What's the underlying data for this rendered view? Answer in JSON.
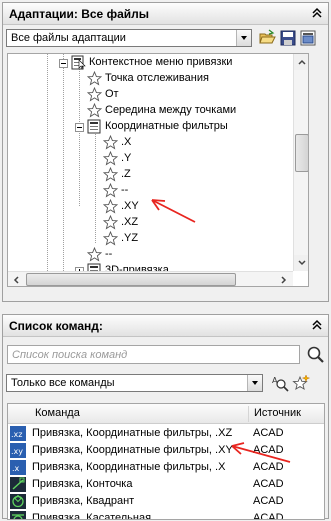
{
  "adapt": {
    "title": "Адаптации: Все файлы",
    "dropdown_value": "Все файлы адаптации",
    "tree": [
      {
        "label": "Контекстное меню привязки",
        "icon": "menu-group-icon"
      },
      {
        "label": "Точка отслеживания",
        "icon": "star-icon"
      },
      {
        "label": "От",
        "icon": "star-icon"
      },
      {
        "label": "Середина между точками",
        "icon": "star-icon"
      },
      {
        "label": "Координатные фильтры",
        "icon": "menu-group-icon"
      },
      {
        "label": ".X",
        "icon": "star-icon"
      },
      {
        "label": ".Y",
        "icon": "star-icon"
      },
      {
        "label": ".Z",
        "icon": "star-icon"
      },
      {
        "label": "--",
        "icon": "star-icon"
      },
      {
        "label": ".XY",
        "icon": "star-icon"
      },
      {
        "label": ".XZ",
        "icon": "star-icon"
      },
      {
        "label": ".YZ",
        "icon": "star-icon"
      },
      {
        "label": "--",
        "icon": "star-icon"
      },
      {
        "label": "3D-привязка",
        "icon": "menu-group-icon"
      },
      {
        "label": "--",
        "icon": "star-icon"
      }
    ]
  },
  "commands": {
    "title": "Список команд:",
    "search_placeholder": "Список поиска команд",
    "filter_value": "Только все команды",
    "col_command": "Команда",
    "col_source": "Источник",
    "rows": [
      {
        "icon_text": ".xz",
        "name": "Привязка, Координатные фильтры, .XZ",
        "source": "ACAD"
      },
      {
        "icon_text": ".xy",
        "name": "Привязка, Координатные фильтры, .XY",
        "source": "ACAD"
      },
      {
        "icon_text": ".x",
        "name": "Привязка, Координатные фильтры, .X",
        "source": "ACAD"
      },
      {
        "icon_text": "",
        "name": "Привязка, Конточка",
        "source": "ACAD"
      },
      {
        "icon_text": "",
        "name": "Привязка, Квадрант",
        "source": "ACAD"
      },
      {
        "icon_text": "",
        "name": "Привязка, Касательная",
        "source": "ACAD"
      }
    ]
  },
  "colors": {
    "annotation_arrow": "#e8251f",
    "icon_blue": "#2a5fb0"
  }
}
